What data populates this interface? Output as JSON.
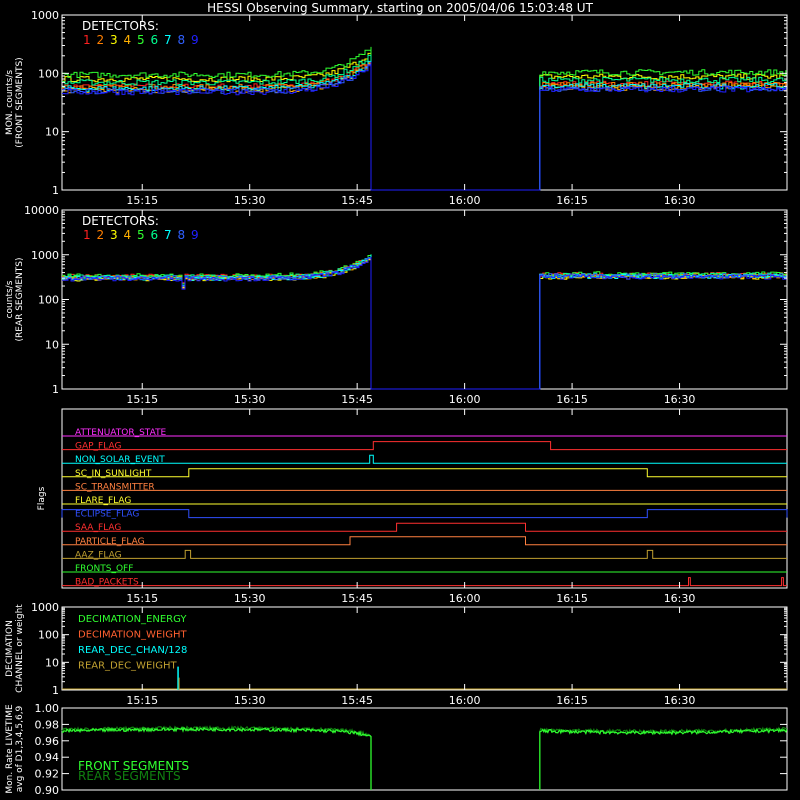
{
  "title": "HESSI Observing Summary, starting on 2005/04/06 15:03:48 UT",
  "time_ticks": [
    "15:15",
    "15:30",
    "15:45",
    "16:00",
    "16:15",
    "16:30"
  ],
  "colors": {
    "bg": "#000000",
    "axis": "#ffffff",
    "det": [
      "#ff2020",
      "#ff7f00",
      "#ffff00",
      "#ffb000",
      "#30ff30",
      "#00ff90",
      "#00ffff",
      "#3060ff",
      "#2020ff"
    ]
  },
  "chart_data": [
    {
      "type": "line",
      "id": "front",
      "ylabel_lines": [
        "MON. counts/s",
        "(FRONT SEGMENTS)"
      ],
      "ylim": [
        1,
        1000
      ],
      "yscale": "log",
      "yticks": [
        "1",
        "10",
        "100",
        "1000"
      ],
      "legend_title": "DETECTORS:",
      "legend_items": [
        "1",
        "2",
        "3",
        "4",
        "5",
        "6",
        "7",
        "8",
        "9"
      ],
      "gap": {
        "start": "15:47:15",
        "end": "16:10:30"
      },
      "series_levels": [
        60,
        58,
        80,
        52,
        95,
        70,
        55,
        50,
        48
      ]
    },
    {
      "type": "line",
      "id": "rear",
      "ylabel_lines": [
        "counts/s",
        "(REAR SEGMENTS)"
      ],
      "ylim": [
        1,
        10000
      ],
      "yscale": "log",
      "yticks": [
        "1",
        "10",
        "100",
        "1000",
        "10000"
      ],
      "legend_title": "DETECTORS:",
      "legend_items": [
        "1",
        "2",
        "3",
        "4",
        "5",
        "6",
        "7",
        "8",
        "9"
      ],
      "gap": {
        "start": "15:47:15",
        "end": "16:10:30"
      },
      "series_levels": [
        330,
        310,
        290,
        300,
        340,
        320,
        300,
        310,
        290
      ]
    },
    {
      "type": "flags",
      "id": "flags",
      "ylabel": "Flags",
      "flags": [
        {
          "name": "ATTENUATOR_STATE",
          "color": "#ff30ff",
          "on": []
        },
        {
          "name": "GAP_FLAG",
          "color": "#ff3030",
          "on": [
            [
              "15:47:15",
              "16:12:00"
            ]
          ]
        },
        {
          "name": "NON_SOLAR_EVENT",
          "color": "#00ffff",
          "on": [
            [
              "15:46:45",
              "15:47:15"
            ]
          ]
        },
        {
          "name": "SC_IN_SUNLIGHT",
          "color": "#ffff30",
          "on": [
            [
              "15:21:30",
              "16:25:30"
            ]
          ]
        },
        {
          "name": "SC_TRANSMITTER",
          "color": "#ff8040",
          "on": []
        },
        {
          "name": "FLARE_FLAG",
          "color": "#ffff30",
          "on": []
        },
        {
          "name": "ECLIPSE_FLAG",
          "color": "#3050ff",
          "on": [
            [
              "15:03:48",
              "15:21:30"
            ],
            [
              "16:25:30",
              "16:45:00"
            ]
          ]
        },
        {
          "name": "SAA_FLAG",
          "color": "#ff3030",
          "on": [
            [
              "15:50:30",
              "16:08:30"
            ]
          ]
        },
        {
          "name": "PARTICLE_FLAG",
          "color": "#ff8040",
          "on": [
            [
              "15:44:00",
              "16:08:30"
            ]
          ]
        },
        {
          "name": "AAZ_FLAG",
          "color": "#c0a030",
          "on": [
            [
              "15:21:00",
              "15:21:45"
            ],
            [
              "16:25:30",
              "16:26:15"
            ]
          ]
        },
        {
          "name": "FRONTS_OFF",
          "color": "#30ff30",
          "on": []
        },
        {
          "name": "BAD_PACKETS",
          "color": "#ff3030",
          "on": [
            [
              "16:31:15",
              "16:31:30"
            ],
            [
              "16:44:15",
              "16:44:30"
            ]
          ]
        }
      ]
    },
    {
      "type": "line",
      "id": "decim",
      "ylabel_lines": [
        "DECIMATION",
        "CHANNEL or weight"
      ],
      "ylim": [
        1,
        1000
      ],
      "yscale": "log",
      "yticks": [
        "1",
        "10",
        "100",
        "1000"
      ],
      "legend_items": [
        {
          "name": "DECIMATION_ENERGY",
          "color": "#30ff30"
        },
        {
          "name": "DECIMATION_WEIGHT",
          "color": "#ff6030"
        },
        {
          "name": "REAR_DEC_CHAN/128",
          "color": "#00ffff"
        },
        {
          "name": "REAR_DEC_WEIGHT",
          "color": "#c0a030"
        }
      ],
      "spike": {
        "time": "15:20:00",
        "value": 7
      }
    },
    {
      "type": "line",
      "id": "livetime",
      "ylabel_lines": [
        "Mon. Rate LIVETIME",
        "avg of D1,3,4,5,6,9"
      ],
      "ylim": [
        0.9,
        1.0
      ],
      "yticks": [
        "0.90",
        "0.92",
        "0.94",
        "0.96",
        "0.98",
        "1.00"
      ],
      "legend_items": [
        {
          "name": "FRONT SEGMENTS",
          "color": "#30ff30"
        },
        {
          "name": "REAR SEGMENTS",
          "color": "#108010"
        }
      ],
      "gap": {
        "start": "15:47:15",
        "end": "16:10:30"
      },
      "level": 0.972
    }
  ]
}
